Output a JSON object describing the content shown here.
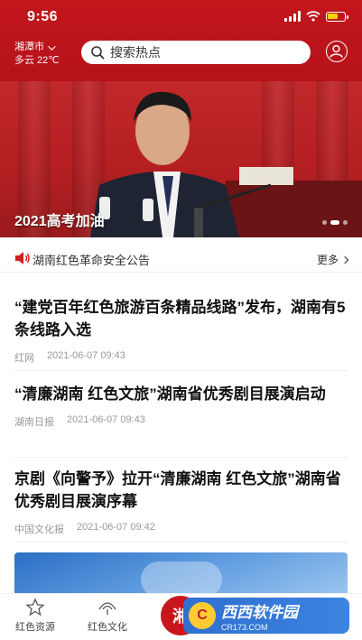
{
  "status_bar": {
    "time": "9:56"
  },
  "header": {
    "city": "湘潭市",
    "weather": "多云 22℃",
    "search_placeholder": "搜索热点",
    "accent_color": "#c3161c"
  },
  "banner": {
    "caption": "2021高考加油",
    "slide_count": 3,
    "active_slide": 1
  },
  "notice": {
    "text": "湖南红色革命安全公告",
    "more_label": "更多"
  },
  "articles": [
    {
      "title": "“建党百年红色旅游百条精品线路”发布，湖南有5条线路入选",
      "source": "红网",
      "time": "2021-06-07 09:43"
    },
    {
      "title": "“清廉湖南 红色文旅”湖南省优秀剧目展演启动",
      "source": "湖南日报",
      "time": "2021-06-07 09:43"
    },
    {
      "title": "京剧《向警予》拉开“清廉湖南 红色文旅”湖南省优秀剧目展演序幕",
      "source": "中国文化报",
      "time": "2021-06-07 09:42"
    }
  ],
  "tabbar": {
    "items": [
      {
        "label": "红色资源",
        "icon": "star-icon"
      },
      {
        "label": "红色文化",
        "icon": "fan-icon"
      }
    ],
    "center_label": "湘"
  },
  "watermark": {
    "logo": "C",
    "site_name": "西西软件园",
    "domain": "CR173.COM"
  }
}
